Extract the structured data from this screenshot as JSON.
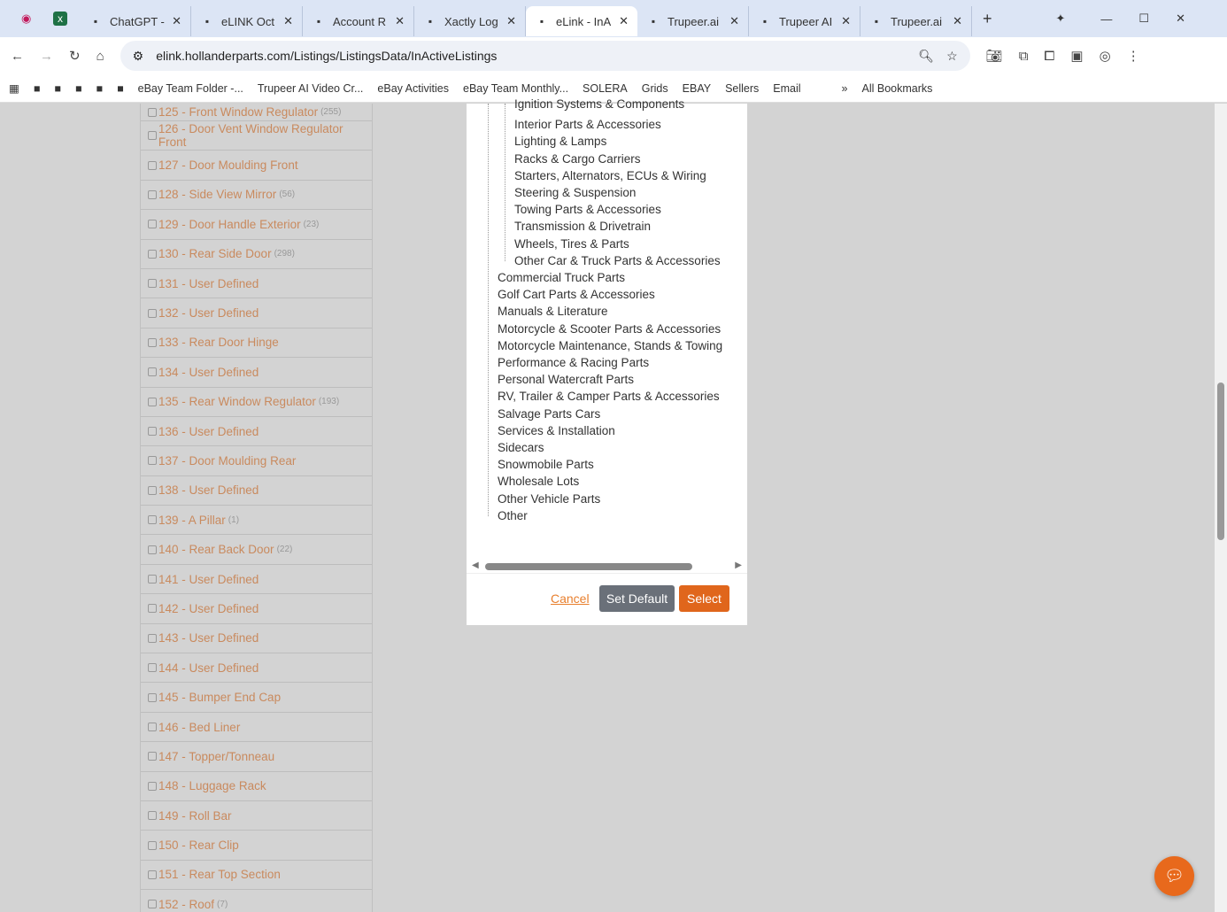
{
  "browser": {
    "tabs": [
      {
        "label": "ChatGPT -",
        "icon": "chatgpt-icon"
      },
      {
        "label": "eLINK Oct",
        "icon": "globe-icon"
      },
      {
        "label": "Account R",
        "icon": "salesforce-icon"
      },
      {
        "label": "Xactly Log",
        "icon": "xactly-icon"
      },
      {
        "label": "eLink - InA",
        "icon": "document-icon",
        "active": true
      },
      {
        "label": "Trupeer.ai",
        "icon": "trupeer-icon"
      },
      {
        "label": "Trupeer AI",
        "icon": "chrome-icon"
      },
      {
        "label": "Trupeer.ai",
        "icon": "trupeer-icon"
      }
    ],
    "url": "elink.hollanderparts.com/Listings/ListingsData/InActiveListings",
    "bookmarks": [
      "eBay Team Folder -...",
      "Trupeer AI Video Cr...",
      "eBay Activities",
      "eBay Team Monthly...",
      "SOLERA",
      "Grids",
      "EBAY",
      "Sellers",
      "Email",
      "All Bookmarks"
    ]
  },
  "list": [
    {
      "label": "125 - Front Window Regulator",
      "count": "(255)"
    },
    {
      "label": "126 - Door Vent Window Regulator Front",
      "count": ""
    },
    {
      "label": "127 - Door Moulding Front",
      "count": ""
    },
    {
      "label": "128 - Side View Mirror",
      "count": "(56)"
    },
    {
      "label": "129 - Door Handle Exterior",
      "count": "(23)"
    },
    {
      "label": "130 - Rear Side Door",
      "count": "(298)"
    },
    {
      "label": "131 - User Defined",
      "count": ""
    },
    {
      "label": "132 - User Defined",
      "count": ""
    },
    {
      "label": "133 - Rear Door Hinge",
      "count": ""
    },
    {
      "label": "134 - User Defined",
      "count": ""
    },
    {
      "label": "135 - Rear Window Regulator",
      "count": "(193)"
    },
    {
      "label": "136 - User Defined",
      "count": ""
    },
    {
      "label": "137 - Door Moulding Rear",
      "count": ""
    },
    {
      "label": "138 - User Defined",
      "count": ""
    },
    {
      "label": "139 - A Pillar",
      "count": "(1)"
    },
    {
      "label": "140 - Rear Back Door",
      "count": "(22)"
    },
    {
      "label": "141 - User Defined",
      "count": ""
    },
    {
      "label": "142 - User Defined",
      "count": ""
    },
    {
      "label": "143 - User Defined",
      "count": ""
    },
    {
      "label": "144 - User Defined",
      "count": ""
    },
    {
      "label": "145 - Bumper End Cap",
      "count": ""
    },
    {
      "label": "146 - Bed Liner",
      "count": ""
    },
    {
      "label": "147 - Topper/Tonneau",
      "count": ""
    },
    {
      "label": "148 - Luggage Rack",
      "count": ""
    },
    {
      "label": "149 - Roll Bar",
      "count": ""
    },
    {
      "label": "150 - Rear Clip",
      "count": ""
    },
    {
      "label": "151 - Rear Top Section",
      "count": ""
    },
    {
      "label": "152 - Roof",
      "count": "(7)"
    }
  ],
  "tree": {
    "sub": [
      "Ignition Systems & Components",
      "Interior Parts & Accessories",
      "Lighting & Lamps",
      "Racks & Cargo Carriers",
      "Starters, Alternators, ECUs & Wiring",
      "Steering & Suspension",
      "Towing Parts & Accessories",
      "Transmission & Drivetrain",
      "Wheels, Tires & Parts",
      "Other Car & Truck Parts & Accessories"
    ],
    "top": [
      "Commercial Truck Parts",
      "Golf Cart Parts & Accessories",
      "Manuals & Literature",
      "Motorcycle & Scooter Parts & Accessories",
      "Motorcycle Maintenance, Stands & Towing",
      "Performance & Racing Parts",
      "Personal Watercraft Parts",
      "RV, Trailer & Camper Parts & Accessories",
      "Salvage Parts Cars",
      "Services & Installation",
      "Sidecars",
      "Snowmobile Parts",
      "Wholesale Lots",
      "Other Vehicle Parts",
      "Other"
    ]
  },
  "dialog": {
    "cancel": "Cancel",
    "set_default": "Set Default",
    "select": "Select"
  }
}
